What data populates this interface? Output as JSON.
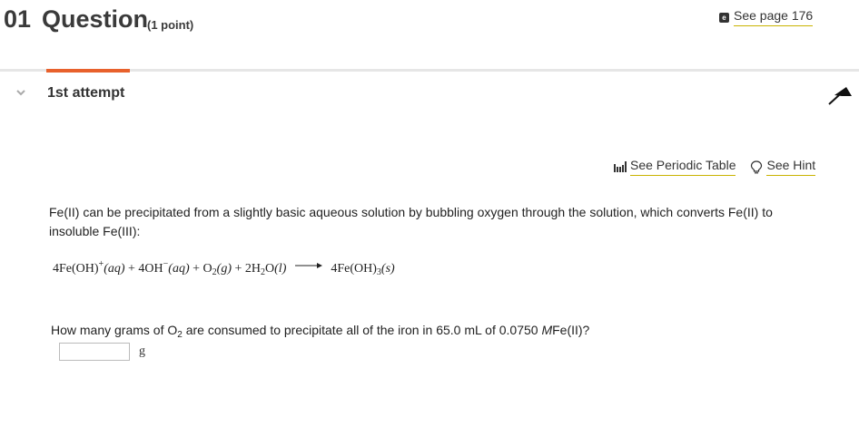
{
  "header": {
    "number": "01",
    "title": "Question",
    "points": "(1 point)",
    "see_page_icon": "ebook-icon",
    "see_page_label": "See page 176"
  },
  "attempt": {
    "label": "1st attempt",
    "accent_color": "#e8612c"
  },
  "tools": {
    "periodic_table_icon": "periodic-table-icon",
    "periodic_table_label": "See Periodic Table",
    "hint_icon": "lightbulb-icon",
    "hint_label": "See Hint"
  },
  "prompt": {
    "text": "Fe(II) can be precipitated from a slightly basic aqueous solution by bubbling oxygen through the solution, which converts Fe(II) to insoluble Fe(III):"
  },
  "equation": {
    "reactant1_coeff": "4Fe",
    "reactant1_formula": "(OH)",
    "reactant1_charge": "+",
    "reactant1_state": "(aq)",
    "plus1": "+",
    "reactant2": "4OH",
    "reactant2_charge": "−",
    "reactant2_state": "(aq)",
    "plus2": "+",
    "reactant3": "O",
    "reactant3_sub": "2",
    "reactant3_state": "(g)",
    "plus3": "+",
    "reactant4_a": "2H",
    "reactant4_sub": "2",
    "reactant4_b": "O",
    "reactant4_state": "(l)",
    "product_coeff": "4Fe",
    "product_formula": "(OH)",
    "product_sub": "3",
    "product_state": "(s)"
  },
  "question": {
    "part1": "How many grams of O",
    "sub": "2",
    "part2": " are consumed to precipitate all of the iron in 65.0 mL of 0.0750 ",
    "molar": "M",
    "part3": "Fe(II)?"
  },
  "answer": {
    "value": "",
    "placeholder": "",
    "unit": "g"
  }
}
